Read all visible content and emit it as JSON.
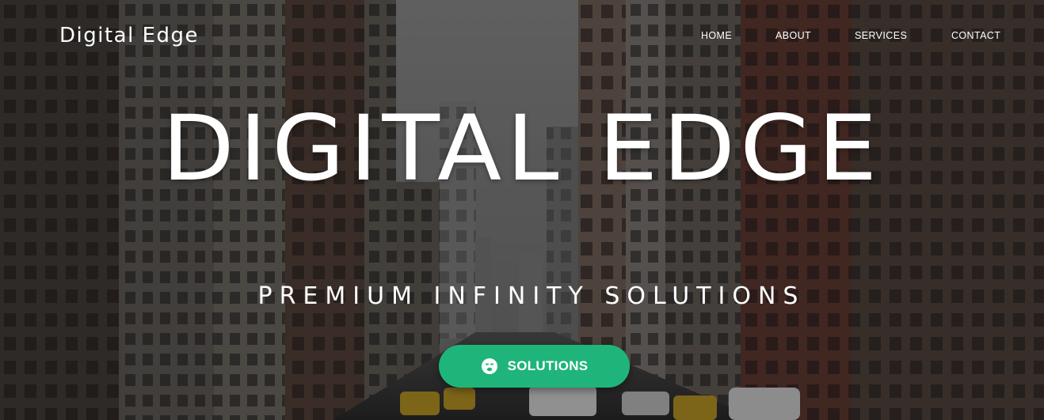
{
  "brand": {
    "name": "Digital Edge"
  },
  "nav": {
    "items": [
      {
        "label": "HOME"
      },
      {
        "label": "ABOUT"
      },
      {
        "label": "SERVICES"
      },
      {
        "label": "CONTACT"
      }
    ]
  },
  "hero": {
    "title": "DIGITAL EDGE",
    "subtitle": "PREMIUM INFINITY SOLUTIONS",
    "cta_label": "SOLUTIONS",
    "cta_icon": "emoji-face-icon"
  },
  "colors": {
    "accent": "#1fb57a",
    "text": "#ffffff"
  }
}
